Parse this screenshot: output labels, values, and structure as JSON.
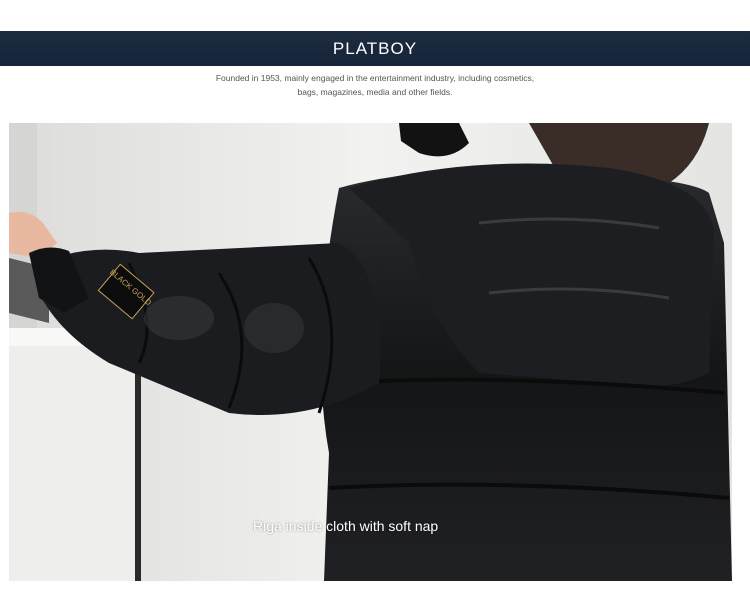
{
  "header": {
    "brand": "PLATBOY",
    "description_line1": "Founded in 1953, mainly engaged in the entertainment industry, including cosmetics,",
    "description_line2": "bags, magazines, media and other fields."
  },
  "photo": {
    "caption": "Riga inside cloth with soft nap",
    "sleeve_patch": "BLACK GOLD",
    "jacket_color": "#1a1b1d",
    "banner_color": "#17263a"
  }
}
